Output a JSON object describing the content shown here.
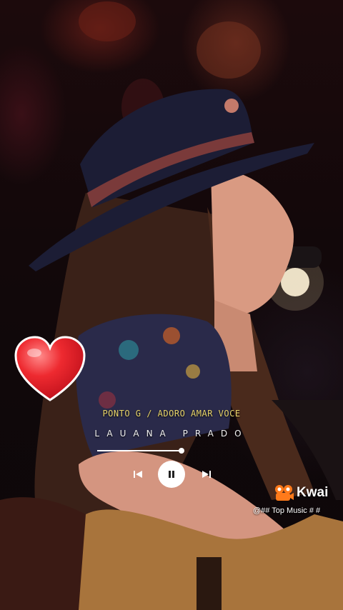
{
  "player": {
    "song_title": "PONTO G / ADORO AMAR VOCE",
    "artist": "LAUANA PRADO",
    "progress": 0.98
  },
  "watermark": {
    "brand": "Kwai",
    "handle": "@## Top Music # #"
  },
  "colors": {
    "title_text": "#e8d46a",
    "heart": "#e8222c",
    "brand_orange": "#ff7a1a"
  },
  "icons": [
    "heart-sticker-icon",
    "previous-track-icon",
    "pause-icon",
    "next-track-icon",
    "kwai-logo-icon"
  ]
}
